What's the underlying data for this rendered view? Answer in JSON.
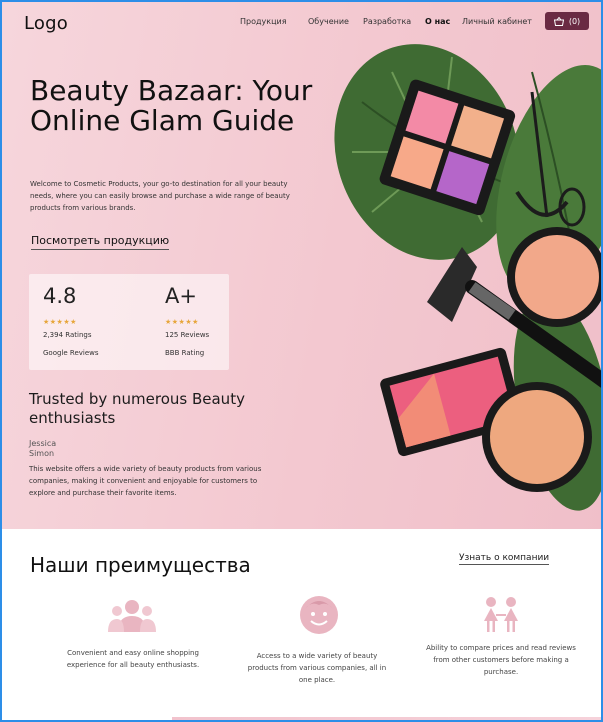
{
  "header": {
    "logo": "Logo",
    "nav": [
      "Продукция",
      "Обучение",
      "Разработка",
      "О нас",
      "Личный кабинет"
    ],
    "active_nav": "О нас",
    "cart_count": "(0)"
  },
  "hero": {
    "title": "Beauty Bazaar: Your Online Glam Guide",
    "description": "Welcome to Cosmetic Products, your go-to destination for all your beauty needs, where you can easily browse and purchase a wide range of beauty products from various brands.",
    "cta": "Посмотреть продукцию"
  },
  "stats": [
    {
      "value": "4.8",
      "stars": "★★★★★",
      "line1": "2,394 Ratings",
      "line2": "Google Reviews"
    },
    {
      "value": "A+",
      "stars": "★★★★★",
      "line1": "125 Reviews",
      "line2": "BBB Rating"
    }
  ],
  "trusted": {
    "heading": "Trusted by numerous Beauty enthusiasts",
    "author_first": "Jessica",
    "author_last": "Simon",
    "quote": "This website offers a wide variety of beauty products from various companies, making it convenient and enjoyable for customers to explore and purchase their favorite items."
  },
  "advantages": {
    "title": "Наши преимущества",
    "about_link": "Узнать о компании",
    "items": [
      {
        "icon": "group-people-icon",
        "text": "Convenient and easy online shopping experience for all beauty enthusiasts."
      },
      {
        "icon": "smiley-face-icon",
        "text": "Access to a wide variety of beauty products from various companies, all in one place."
      },
      {
        "icon": "two-kids-icon",
        "text": "Ability to compare prices and read reviews from other customers before making a purchase."
      }
    ]
  },
  "colors": {
    "hero_bg": "#f3c8d0",
    "accent": "#6a2a43",
    "icon_pink": "#e9b5c1",
    "star": "#e7a63b"
  }
}
